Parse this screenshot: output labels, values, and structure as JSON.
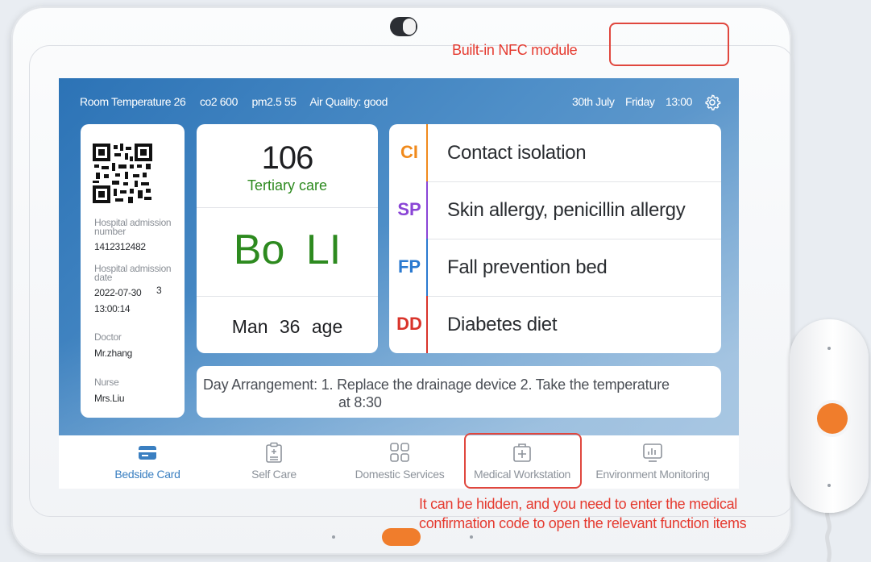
{
  "status_bar": {
    "room_temperature": "Room Temperature  26",
    "co2": "co2  600",
    "pm25": "pm2.5  55",
    "air_quality": "Air Quality: good",
    "date": "30th July",
    "weekday": "Friday",
    "time": "13:00",
    "settings_icon": "gear-icon"
  },
  "patient_info": {
    "qr_icon": "qr-code-icon",
    "admission_number_label": "Hospital admission number",
    "admission_number": "1412312482",
    "admission_date_label": "Hospital admission date",
    "admission_date": "2022-07-30",
    "admission_days": "3",
    "admission_time": "13:00:14",
    "doctor_label": "Doctor",
    "doctor": "Mr.zhang",
    "nurse_label": "Nurse",
    "nurse": "Mrs.Liu"
  },
  "bed": {
    "number": "106",
    "care_level": "Tertiary care",
    "patient_name": "Bo  LI",
    "gender": "Man",
    "age": "36 age"
  },
  "tags": [
    {
      "code": "CI",
      "text": "Contact isolation",
      "color": "#f08a1c"
    },
    {
      "code": "SP",
      "text": "Skin allergy, penicillin allergy",
      "color": "#8a45d6"
    },
    {
      "code": "FP",
      "text": "Fall prevention bed",
      "color": "#2b7ad0"
    },
    {
      "code": "DD",
      "text": "Diabetes diet",
      "color": "#d9342b"
    }
  ],
  "arrangement": {
    "label": "Day Arrangement:",
    "line1": "1. Replace the drainage device   2. Take the temperature",
    "line2": "at 8:30"
  },
  "nav": [
    {
      "label": "Bedside Card",
      "icon": "card-icon",
      "active": true
    },
    {
      "label": "Self Care",
      "icon": "clipboard-icon",
      "active": false
    },
    {
      "label": "Domestic Services",
      "icon": "grid-icon",
      "active": false
    },
    {
      "label": "Medical Workstation",
      "icon": "medical-kit-icon",
      "active": false
    },
    {
      "label": "Environment Monitoring",
      "icon": "monitor-chart-icon",
      "active": false
    }
  ],
  "annotations": {
    "nfc": "Built-in NFC module",
    "hidden_line1": "It can be hidden, and you need to enter the medical",
    "hidden_line2": "confirmation code to open the relevant function items"
  },
  "colors": {
    "accent": "#3a7fc1",
    "care_green": "#2d8a1f",
    "annotation_red": "#e0473e",
    "button_orange": "#f07d2c"
  }
}
